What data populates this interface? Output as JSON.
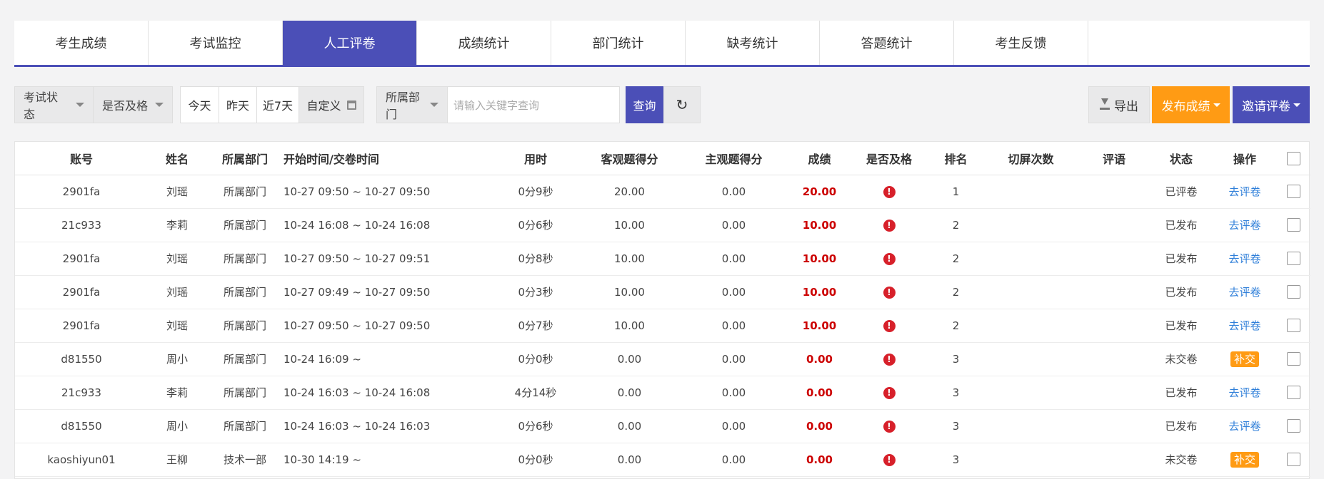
{
  "tabs": [
    {
      "label": "考生成绩"
    },
    {
      "label": "考试监控"
    },
    {
      "label": "人工评卷"
    },
    {
      "label": "成绩统计"
    },
    {
      "label": "部门统计"
    },
    {
      "label": "缺考统计"
    },
    {
      "label": "答题统计"
    },
    {
      "label": "考生反馈"
    }
  ],
  "active_tab": "人工评卷",
  "filters": {
    "exam_status": "考试状态",
    "pass_status": "是否及格",
    "today": "今天",
    "yesterday": "昨天",
    "last7": "近7天",
    "custom": "自定义",
    "department": "所属部门",
    "search_placeholder": "请输入关键字查询",
    "search": "查询",
    "reset_icon": "↻"
  },
  "actions": {
    "export": "导出",
    "publish": "发布成绩",
    "invite": "邀请评卷"
  },
  "table": {
    "headers": {
      "account": "账号",
      "name": "姓名",
      "dept": "所属部门",
      "time": "开始时间/交卷时间",
      "duration": "用时",
      "objective": "客观题得分",
      "subjective": "主观题得分",
      "score": "成绩",
      "passed": "是否及格",
      "rank": "排名",
      "switch": "切屏次数",
      "comment": "评语",
      "status": "状态",
      "op": "操作"
    },
    "rows": [
      {
        "account": "2901fa",
        "name": "刘瑶",
        "dept": "所属部门",
        "time": "10-27 09:50 ~ 10-27 09:50",
        "duration": "0分9秒",
        "objective": "20.00",
        "subjective": "0.00",
        "score": "20.00",
        "rank": "1",
        "status": "已评卷",
        "op": "去评卷",
        "op_type": "link"
      },
      {
        "account": "21c933",
        "name": "李莉",
        "dept": "所属部门",
        "time": "10-24 16:08 ~ 10-24 16:08",
        "duration": "0分6秒",
        "objective": "10.00",
        "subjective": "0.00",
        "score": "10.00",
        "rank": "2",
        "status": "已发布",
        "op": "去评卷",
        "op_type": "link"
      },
      {
        "account": "2901fa",
        "name": "刘瑶",
        "dept": "所属部门",
        "time": "10-27 09:50 ~ 10-27 09:51",
        "duration": "0分8秒",
        "objective": "10.00",
        "subjective": "0.00",
        "score": "10.00",
        "rank": "2",
        "status": "已发布",
        "op": "去评卷",
        "op_type": "link"
      },
      {
        "account": "2901fa",
        "name": "刘瑶",
        "dept": "所属部门",
        "time": "10-27 09:49 ~ 10-27 09:50",
        "duration": "0分3秒",
        "objective": "10.00",
        "subjective": "0.00",
        "score": "10.00",
        "rank": "2",
        "status": "已发布",
        "op": "去评卷",
        "op_type": "link"
      },
      {
        "account": "2901fa",
        "name": "刘瑶",
        "dept": "所属部门",
        "time": "10-27 09:50 ~ 10-27 09:50",
        "duration": "0分7秒",
        "objective": "10.00",
        "subjective": "0.00",
        "score": "10.00",
        "rank": "2",
        "status": "已发布",
        "op": "去评卷",
        "op_type": "link"
      },
      {
        "account": "d81550",
        "name": "周小",
        "dept": "所属部门",
        "time": "10-24 16:09 ~",
        "duration": "0分0秒",
        "objective": "0.00",
        "subjective": "0.00",
        "score": "0.00",
        "rank": "3",
        "status": "未交卷",
        "op": "补交",
        "op_type": "badge"
      },
      {
        "account": "21c933",
        "name": "李莉",
        "dept": "所属部门",
        "time": "10-24 16:03 ~ 10-24 16:08",
        "duration": "4分14秒",
        "objective": "0.00",
        "subjective": "0.00",
        "score": "0.00",
        "rank": "3",
        "status": "已发布",
        "op": "去评卷",
        "op_type": "link"
      },
      {
        "account": "d81550",
        "name": "周小",
        "dept": "所属部门",
        "time": "10-24 16:03 ~ 10-24 16:03",
        "duration": "0分6秒",
        "objective": "0.00",
        "subjective": "0.00",
        "score": "0.00",
        "rank": "3",
        "status": "已发布",
        "op": "去评卷",
        "op_type": "link"
      },
      {
        "account": "kaoshiyun01",
        "name": "王柳",
        "dept": "技术一部",
        "time": "10-30 14:19 ~",
        "duration": "0分0秒",
        "objective": "0.00",
        "subjective": "0.00",
        "score": "0.00",
        "rank": "3",
        "status": "未交卷",
        "op": "补交",
        "op_type": "badge"
      }
    ]
  },
  "colors": {
    "accent": "#4b4fb7",
    "warning": "#ff9b14",
    "score_red": "#cc0000",
    "link_blue": "#2f7fd9"
  }
}
